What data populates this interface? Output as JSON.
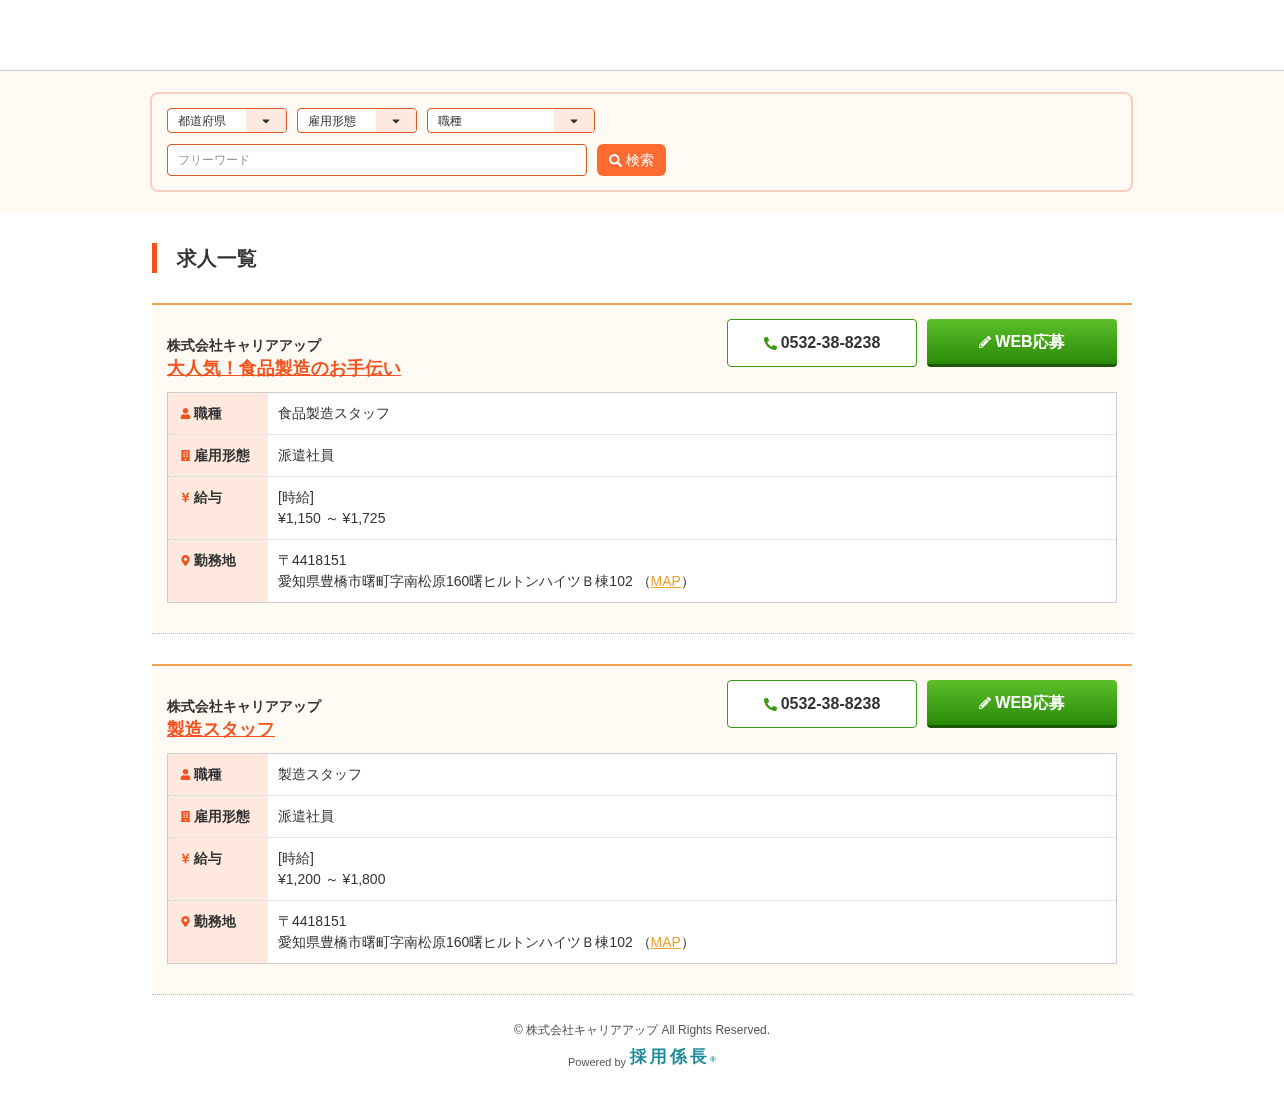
{
  "search": {
    "selects": [
      {
        "label": "都道府県"
      },
      {
        "label": "雇用形態"
      },
      {
        "label": "職種"
      }
    ],
    "keyword": {
      "placeholder": "フリーワード"
    },
    "button": "検索"
  },
  "heading": "求人一覧",
  "jobs": [
    {
      "company": "株式会社キャリアアップ",
      "title": "大人気！食品製造のお手伝い",
      "phone": "0532-38-8238",
      "apply": "WEB応募",
      "rows": [
        {
          "kind": "person",
          "label": "職種",
          "lines": [
            "食品製造スタッフ"
          ]
        },
        {
          "kind": "building",
          "label": "雇用形態",
          "lines": [
            "派遣社員"
          ]
        },
        {
          "kind": "yen",
          "label": "給与",
          "lines": [
            "[時給]",
            "¥1,150 ～ ¥1,725"
          ]
        },
        {
          "kind": "pin",
          "label": "勤務地",
          "lines": [
            "〒4418151",
            "愛知県豊橋市曙町字南松原160曙ヒルトンハイツＢ棟102 "
          ],
          "map": {
            "open": "（",
            "link": "MAP",
            "close": "）"
          }
        }
      ]
    },
    {
      "company": "株式会社キャリアアップ",
      "title": "製造スタッフ",
      "phone": "0532-38-8238",
      "apply": "WEB応募",
      "rows": [
        {
          "kind": "person",
          "label": "職種",
          "lines": [
            "製造スタッフ"
          ]
        },
        {
          "kind": "building",
          "label": "雇用形態",
          "lines": [
            "派遣社員"
          ]
        },
        {
          "kind": "yen",
          "label": "給与",
          "lines": [
            "[時給]",
            "¥1,200 ～ ¥1,800"
          ]
        },
        {
          "kind": "pin",
          "label": "勤務地",
          "lines": [
            "〒4418151",
            "愛知県豊橋市曙町字南松原160曙ヒルトンハイツＢ棟102 "
          ],
          "map": {
            "open": "（",
            "link": "MAP",
            "close": "）"
          }
        }
      ]
    }
  ],
  "footer": {
    "copyright": "© 株式会社キャリアアップ All Rights Reserved.",
    "powered": "Powered by",
    "logo": "採用係長",
    "logo_mark": "®"
  }
}
